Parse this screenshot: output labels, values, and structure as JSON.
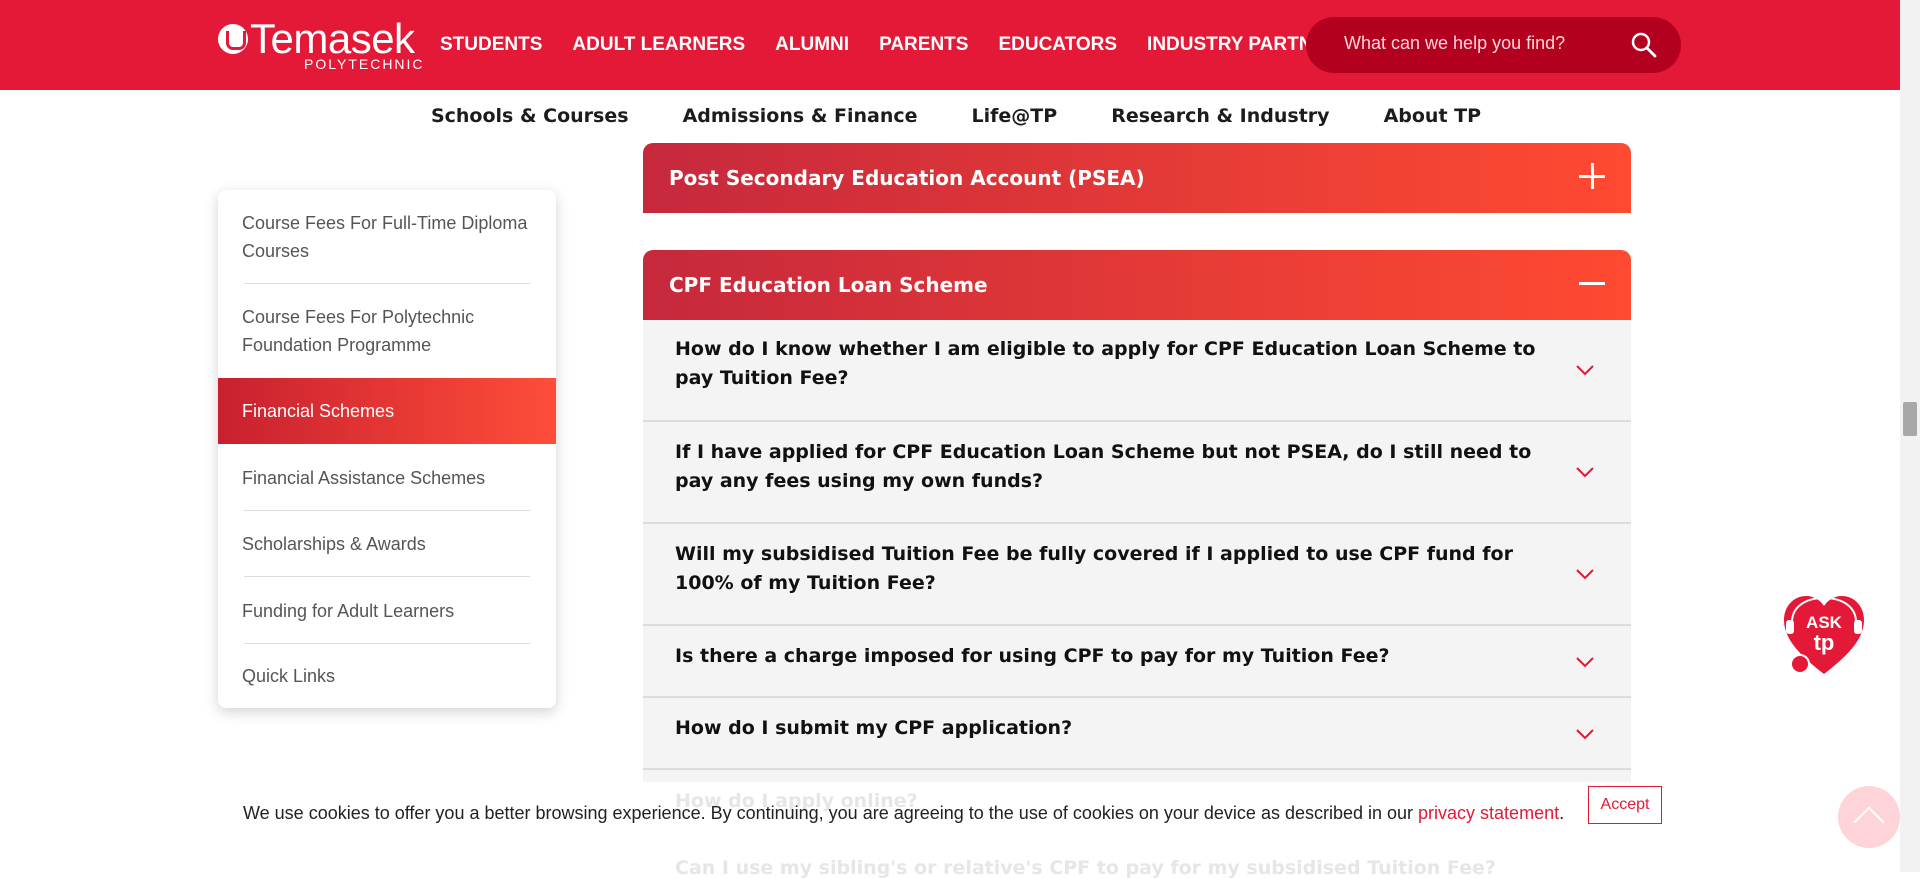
{
  "header": {
    "logo_name": "Temasek",
    "logo_sub": "POLYTECHNIC",
    "nav": [
      "STUDENTS",
      "ADULT LEARNERS",
      "ALUMNI",
      "PARENTS",
      "EDUCATORS",
      "INDUSTRY PARTNERS"
    ],
    "search_placeholder": "What can we help you find?"
  },
  "subnav": [
    "Schools & Courses",
    "Admissions & Finance",
    "Life@TP",
    "Research & Industry",
    "About TP"
  ],
  "sidebar": {
    "items": [
      "Course Fees For Full-Time Diploma Courses",
      "Course Fees For Polytechnic Foundation Programme",
      "Financial Schemes",
      "Financial Assistance Schemes",
      "Scholarships & Awards",
      "Funding for Adult Learners",
      "Quick Links"
    ],
    "active_index": 2
  },
  "accordions": [
    {
      "title": "Post Secondary Education Account (PSEA)",
      "state": "collapsed"
    },
    {
      "title": "CPF Education Loan Scheme",
      "state": "expanded"
    }
  ],
  "faqs": [
    "How do I know whether I am eligible to apply for CPF Education Loan Scheme to pay Tuition Fee?",
    "If I have applied for CPF Education Loan Scheme but not PSEA, do I still need to pay any fees using my own funds?",
    "Will my subsidised Tuition Fee be fully covered if I applied to use CPF fund for 100% of my Tuition Fee?",
    "Is there a charge imposed for using CPF to pay for my Tuition Fee?",
    "How do I submit my CPF application?",
    "How do I apply online?",
    "Can I use my sibling's or relative's CPF to pay for my subsidised Tuition Fee?"
  ],
  "cookie": {
    "text": "We use cookies to offer you a better browsing experience. By continuing, you are agreeing to the use of cookies on your device as described in our ",
    "link": "privacy statement",
    "end": ".",
    "accept": "Accept"
  },
  "ask": {
    "line1": "ASK",
    "line2": "tp"
  },
  "colors": {
    "brand": "#e31937",
    "active_start": "#c8202f",
    "active_end": "#ff4d39"
  }
}
